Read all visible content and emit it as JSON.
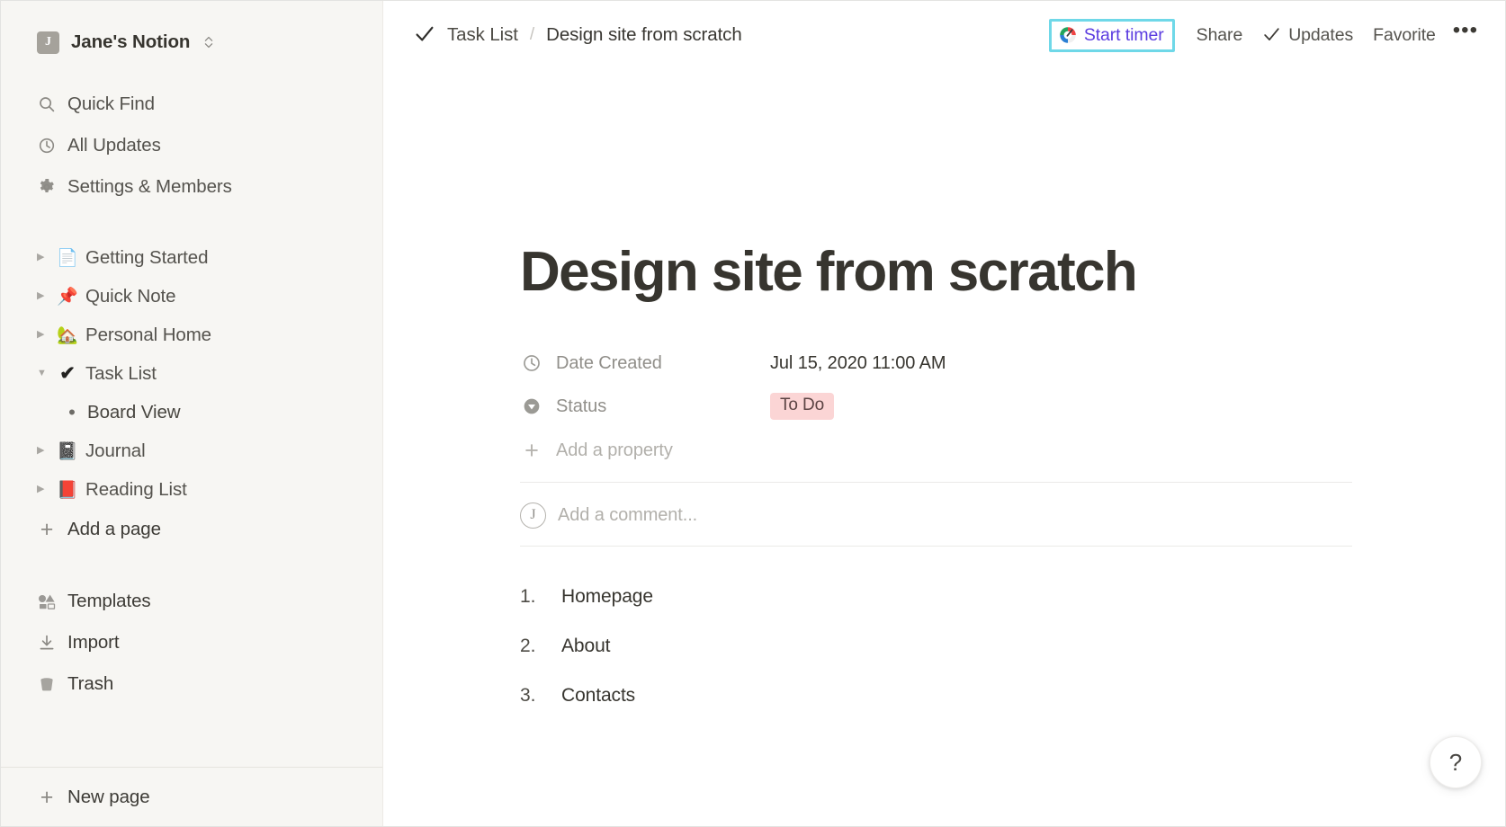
{
  "sidebar": {
    "workspace": {
      "avatar_letter": "J",
      "name": "Jane's Notion",
      "chevron": "⌃⌄"
    },
    "nav": [
      {
        "label": "Quick Find",
        "icon": "search-icon"
      },
      {
        "label": "All Updates",
        "icon": "clock-icon"
      },
      {
        "label": "Settings & Members",
        "icon": "gear-icon"
      }
    ],
    "pages": [
      {
        "label": "Getting Started",
        "emoji": "📄",
        "twisty": "▶",
        "expanded": false
      },
      {
        "label": "Quick Note",
        "emoji": "📌",
        "twisty": "▶",
        "expanded": false
      },
      {
        "label": "Personal Home",
        "emoji": "🏡",
        "twisty": "▶",
        "expanded": false
      },
      {
        "label": "Task List",
        "emoji": "✔",
        "twisty": "▼",
        "expanded": true
      },
      {
        "label": "Board View",
        "emoji": "•",
        "twisty": "",
        "expanded": false,
        "child": true
      },
      {
        "label": "Journal",
        "emoji": "📓",
        "twisty": "▶",
        "expanded": false
      },
      {
        "label": "Reading List",
        "emoji": "📕",
        "twisty": "▶",
        "expanded": false
      }
    ],
    "add_a_page": "Add a page",
    "utilities": [
      {
        "label": "Templates",
        "icon": "templates-icon"
      },
      {
        "label": "Import",
        "icon": "import-icon"
      },
      {
        "label": "Trash",
        "icon": "trash-icon"
      }
    ],
    "new_page": "New page"
  },
  "topbar": {
    "breadcrumb": {
      "check_icon": "check-icon",
      "parent": "Task List",
      "separator": "/",
      "current": "Design site from scratch"
    },
    "start_timer": {
      "label": "Start timer",
      "icon": "timer-gauge-icon",
      "text_color": "#5b3ce0",
      "highlight_color": "#6fd8e8"
    },
    "share": "Share",
    "updates": "Updates",
    "favorite": "Favorite",
    "more": "•••"
  },
  "page": {
    "title": "Design site from scratch",
    "properties": [
      {
        "name": "Date Created",
        "icon": "clock-icon",
        "value": "Jul 15, 2020 11:00 AM",
        "type": "date"
      },
      {
        "name": "Status",
        "icon": "select-icon",
        "value": "To Do",
        "type": "select",
        "pill_bg": "#fbd5d5"
      }
    ],
    "add_property": "Add a property",
    "comment": {
      "avatar_letter": "J",
      "placeholder": "Add a comment..."
    },
    "list": [
      {
        "index": "1.",
        "text": "Homepage"
      },
      {
        "index": "2.",
        "text": "About"
      },
      {
        "index": "3.",
        "text": "Contacts"
      }
    ]
  },
  "help_button": {
    "label": "?"
  }
}
